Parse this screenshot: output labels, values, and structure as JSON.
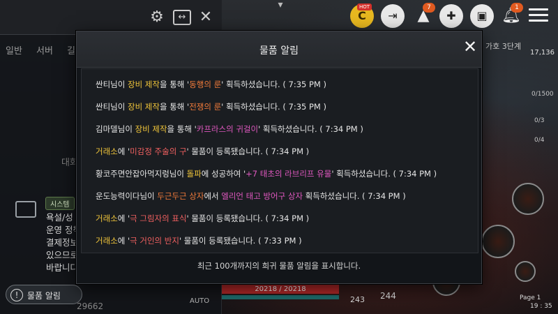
{
  "chat_panel": {
    "tabs": [
      "일반",
      "서버",
      "길"
    ],
    "ghost_line": "대화",
    "system_badge": "시스템",
    "system_lines": [
      "욕설/성",
      "운영 정책",
      "결제정보",
      "있으므로",
      "바랍니다"
    ]
  },
  "notification_pill": {
    "icon": "!",
    "label": "물품 알림"
  },
  "bottom_stat": "29662",
  "auto_label": "AUTO",
  "hud": {
    "hot_label": "HOT",
    "badge_quest": "7",
    "badge_bell": "1",
    "level_text": "가호 3단계",
    "level_num": "17,136",
    "side_counts": [
      "0/1500",
      "0/3",
      "0/4"
    ],
    "hp_text": "20218 / 20218",
    "num_a": "243",
    "num_b": "244",
    "page_label": "Page 1",
    "clock": "19 : 35"
  },
  "modal": {
    "title": "물품 알림",
    "footer": "최근 100개까지의 희귀 물품 알림을 표시합니다.",
    "messages": [
      {
        "pre": "싼티님이 ",
        "hl1": "장비 제작",
        "mid": "을 통해 '",
        "hl2": "동행의 룬",
        "post": "' 획득하셨습니다. ( 7:35 PM )"
      },
      {
        "pre": "싼티님이 ",
        "hl1": "장비 제작",
        "mid": "을 통해 '",
        "hl2": "전쟁의 룬",
        "post": "' 획득하셨습니다. ( 7:35 PM )"
      },
      {
        "pre": "김마델님이 ",
        "hl1": "장비 제작",
        "mid": "을 통해 '",
        "hl2": "카프라스의 귀걸이",
        "post": "' 획득하셨습니다. ( 7:34 PM )"
      },
      {
        "pre": "",
        "hl1": "거래소",
        "mid": "에 '",
        "hl2": "미감정 주술의 구",
        "post": "' 물품이 등록됐습니다. ( 7:34 PM )"
      },
      {
        "pre": "황코주면안잡아먹지렁님이 ",
        "hl1": "돌파",
        "mid": "에 성공하여 '",
        "hl2": "+7 태초의 라브리프 유물",
        "post": "' 획득하셨습니다. ( 7:34 PM )"
      },
      {
        "pre": "운도능력이다님이 ",
        "hl1": "두근두근 상자",
        "mid": "에서 ",
        "hl2": "엘리언 태고 방어구 상자",
        "post": " 획득하셨습니다. ( 7:34 PM )"
      },
      {
        "pre": "",
        "hl1": "거래소",
        "mid": "에 '",
        "hl2": "극 그림자의 표식",
        "post": "' 물품이 등록됐습니다. ( 7:34 PM )"
      },
      {
        "pre": "",
        "hl1": "거래소",
        "mid": "에 '",
        "hl2": "극 거인의 반지",
        "post": "' 물품이 등록됐습니다. ( 7:33 PM )"
      }
    ]
  }
}
